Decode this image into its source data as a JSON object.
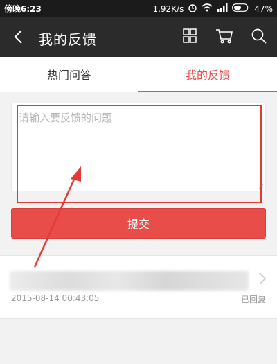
{
  "status_bar": {
    "time": "傍晚6:23",
    "network_speed": "1.92K/s",
    "battery": "47%"
  },
  "app_bar": {
    "title": "我的反馈"
  },
  "tabs": [
    {
      "label": "热门问答",
      "active": false
    },
    {
      "label": "我的反馈",
      "active": true
    }
  ],
  "feedback_input": {
    "placeholder": "请输入要反馈的问题",
    "value": ""
  },
  "submit_button": {
    "label": "提交"
  },
  "feedback_list": [
    {
      "date": "2015-08-14 00:43:05",
      "status": "已回复"
    }
  ],
  "colors": {
    "accent": "#e84d4a",
    "annotation": "#e53935",
    "appbar": "#2b2b2b"
  }
}
